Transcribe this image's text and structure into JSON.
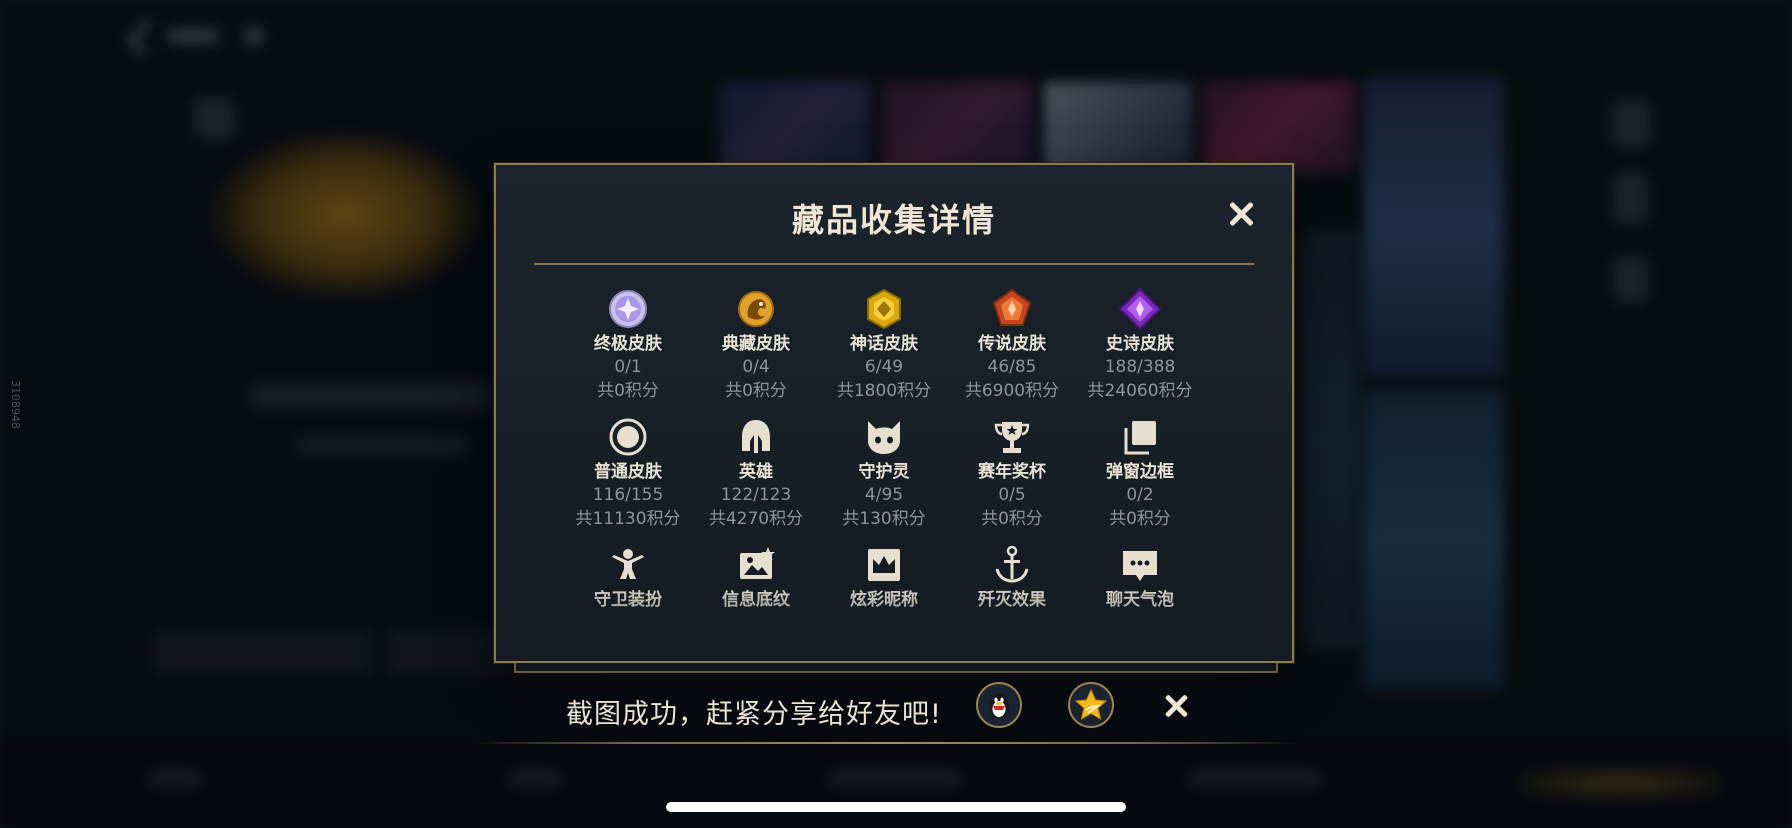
{
  "modal": {
    "title": "藏品收集详情",
    "items": [
      {
        "name": "终极皮肤",
        "count": "0/1",
        "points": "共0积分",
        "icon": "ultimate-skin-icon"
      },
      {
        "name": "典藏皮肤",
        "count": "0/4",
        "points": "共0积分",
        "icon": "collector-skin-icon"
      },
      {
        "name": "神话皮肤",
        "count": "6/49",
        "points": "共1800积分",
        "icon": "mythic-skin-icon"
      },
      {
        "name": "传说皮肤",
        "count": "46/85",
        "points": "共6900积分",
        "icon": "legend-skin-icon"
      },
      {
        "name": "史诗皮肤",
        "count": "188/388",
        "points": "共24060积分",
        "icon": "epic-skin-icon"
      },
      {
        "name": "普通皮肤",
        "count": "116/155",
        "points": "共11130积分",
        "icon": "normal-skin-icon"
      },
      {
        "name": "英雄",
        "count": "122/123",
        "points": "共4270积分",
        "icon": "hero-helmet-icon"
      },
      {
        "name": "守护灵",
        "count": "4/95",
        "points": "共130积分",
        "icon": "guardian-spirit-icon"
      },
      {
        "name": "赛年奖杯",
        "count": "0/5",
        "points": "共0积分",
        "icon": "season-trophy-icon"
      },
      {
        "name": "弹窗边框",
        "count": "0/2",
        "points": "共0积分",
        "icon": "popup-frame-icon"
      },
      {
        "name": "守卫装扮",
        "icon": "guard-outfit-icon"
      },
      {
        "name": "信息底纹",
        "icon": "info-background-icon"
      },
      {
        "name": "炫彩昵称",
        "icon": "colorful-nickname-icon"
      },
      {
        "name": "歼灭效果",
        "icon": "kill-effect-icon"
      },
      {
        "name": "聊天气泡",
        "icon": "chat-bubble-icon"
      }
    ]
  },
  "toast": {
    "text": "截图成功，赶紧分享给好友吧!",
    "share_targets": [
      "qq-penguin-icon",
      "qzone-star-icon"
    ]
  },
  "side_id": "3108948",
  "colors": {
    "gold": "#8f7a4b",
    "panel": "#161d25",
    "text_light": "#e8e2d5",
    "text_muted": "#8d949c"
  }
}
